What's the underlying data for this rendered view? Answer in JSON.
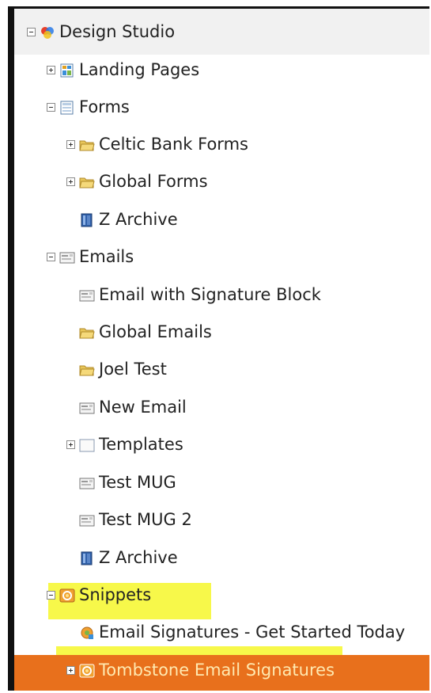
{
  "tree": {
    "root_label": "Design Studio",
    "items": [
      {
        "label": "Landing Pages"
      },
      {
        "label": "Forms"
      },
      {
        "label": "Celtic Bank Forms"
      },
      {
        "label": "Global Forms"
      },
      {
        "label": "Z Archive"
      },
      {
        "label": "Emails"
      },
      {
        "label": "Email with Signature Block"
      },
      {
        "label": "Global Emails"
      },
      {
        "label": "Joel Test"
      },
      {
        "label": "New Email"
      },
      {
        "label": "Templates"
      },
      {
        "label": "Test MUG"
      },
      {
        "label": "Test MUG 2"
      },
      {
        "label": "Z Archive"
      },
      {
        "label": "Snippets"
      },
      {
        "label": "Email Signatures - Get Started Today"
      },
      {
        "label": "Tombstone Email Signatures"
      }
    ]
  },
  "colors": {
    "selected_background": "#e8701c",
    "highlight_yellow": "#f7f84a",
    "root_band": "#f1f1f1"
  }
}
